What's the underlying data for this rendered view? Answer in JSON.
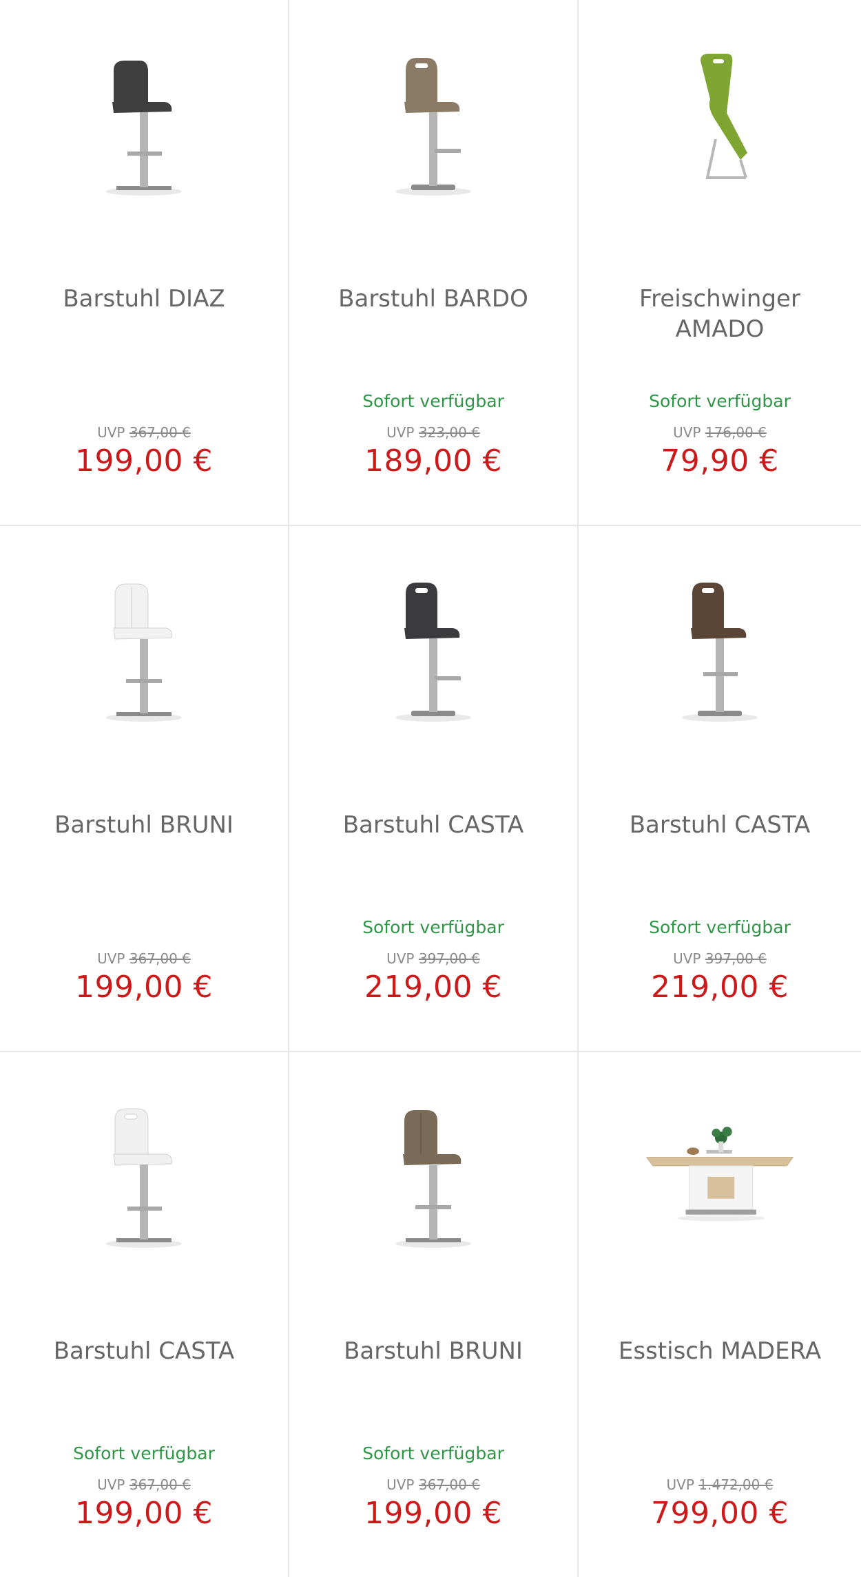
{
  "uvp_label": "UVP",
  "products": [
    {
      "title": "Barstuhl DIAZ",
      "availability": "",
      "uvp": "367,00 €",
      "price": "199,00 €",
      "icon": "barstool-icon",
      "color": "#3f3f3f"
    },
    {
      "title": "Barstuhl BARDO",
      "availability": "Sofort verfügbar",
      "uvp": "323,00 €",
      "price": "189,00 €",
      "icon": "barstool-icon",
      "color": "#8b7b66"
    },
    {
      "title": "Freischwinger AMADO",
      "availability": "Sofort verfügbar",
      "uvp": "176,00 €",
      "price": "79,90 €",
      "icon": "cantilever-chair-icon",
      "color": "#7fa632"
    },
    {
      "title": "Barstuhl BRUNI",
      "availability": "",
      "uvp": "367,00 €",
      "price": "199,00 €",
      "icon": "barstool-icon",
      "color": "#f2f2f2"
    },
    {
      "title": "Barstuhl CASTA",
      "availability": "Sofort verfügbar",
      "uvp": "397,00 €",
      "price": "219,00 €",
      "icon": "barstool-icon",
      "color": "#3b3b3e"
    },
    {
      "title": "Barstuhl CASTA",
      "availability": "Sofort verfügbar",
      "uvp": "397,00 €",
      "price": "219,00 €",
      "icon": "barstool-icon",
      "color": "#5a4536"
    },
    {
      "title": "Barstuhl CASTA",
      "availability": "Sofort verfügbar",
      "uvp": "367,00 €",
      "price": "199,00 €",
      "icon": "barstool-icon",
      "color": "#f0f0f0"
    },
    {
      "title": "Barstuhl BRUNI",
      "availability": "Sofort verfügbar",
      "uvp": "367,00 €",
      "price": "199,00 €",
      "icon": "barstool-icon",
      "color": "#7a6a58"
    },
    {
      "title": "Esstisch MADERA",
      "availability": "",
      "uvp": "1.472,00 €",
      "price": "799,00 €",
      "icon": "dining-table-icon",
      "color": "#d8c09a"
    }
  ]
}
